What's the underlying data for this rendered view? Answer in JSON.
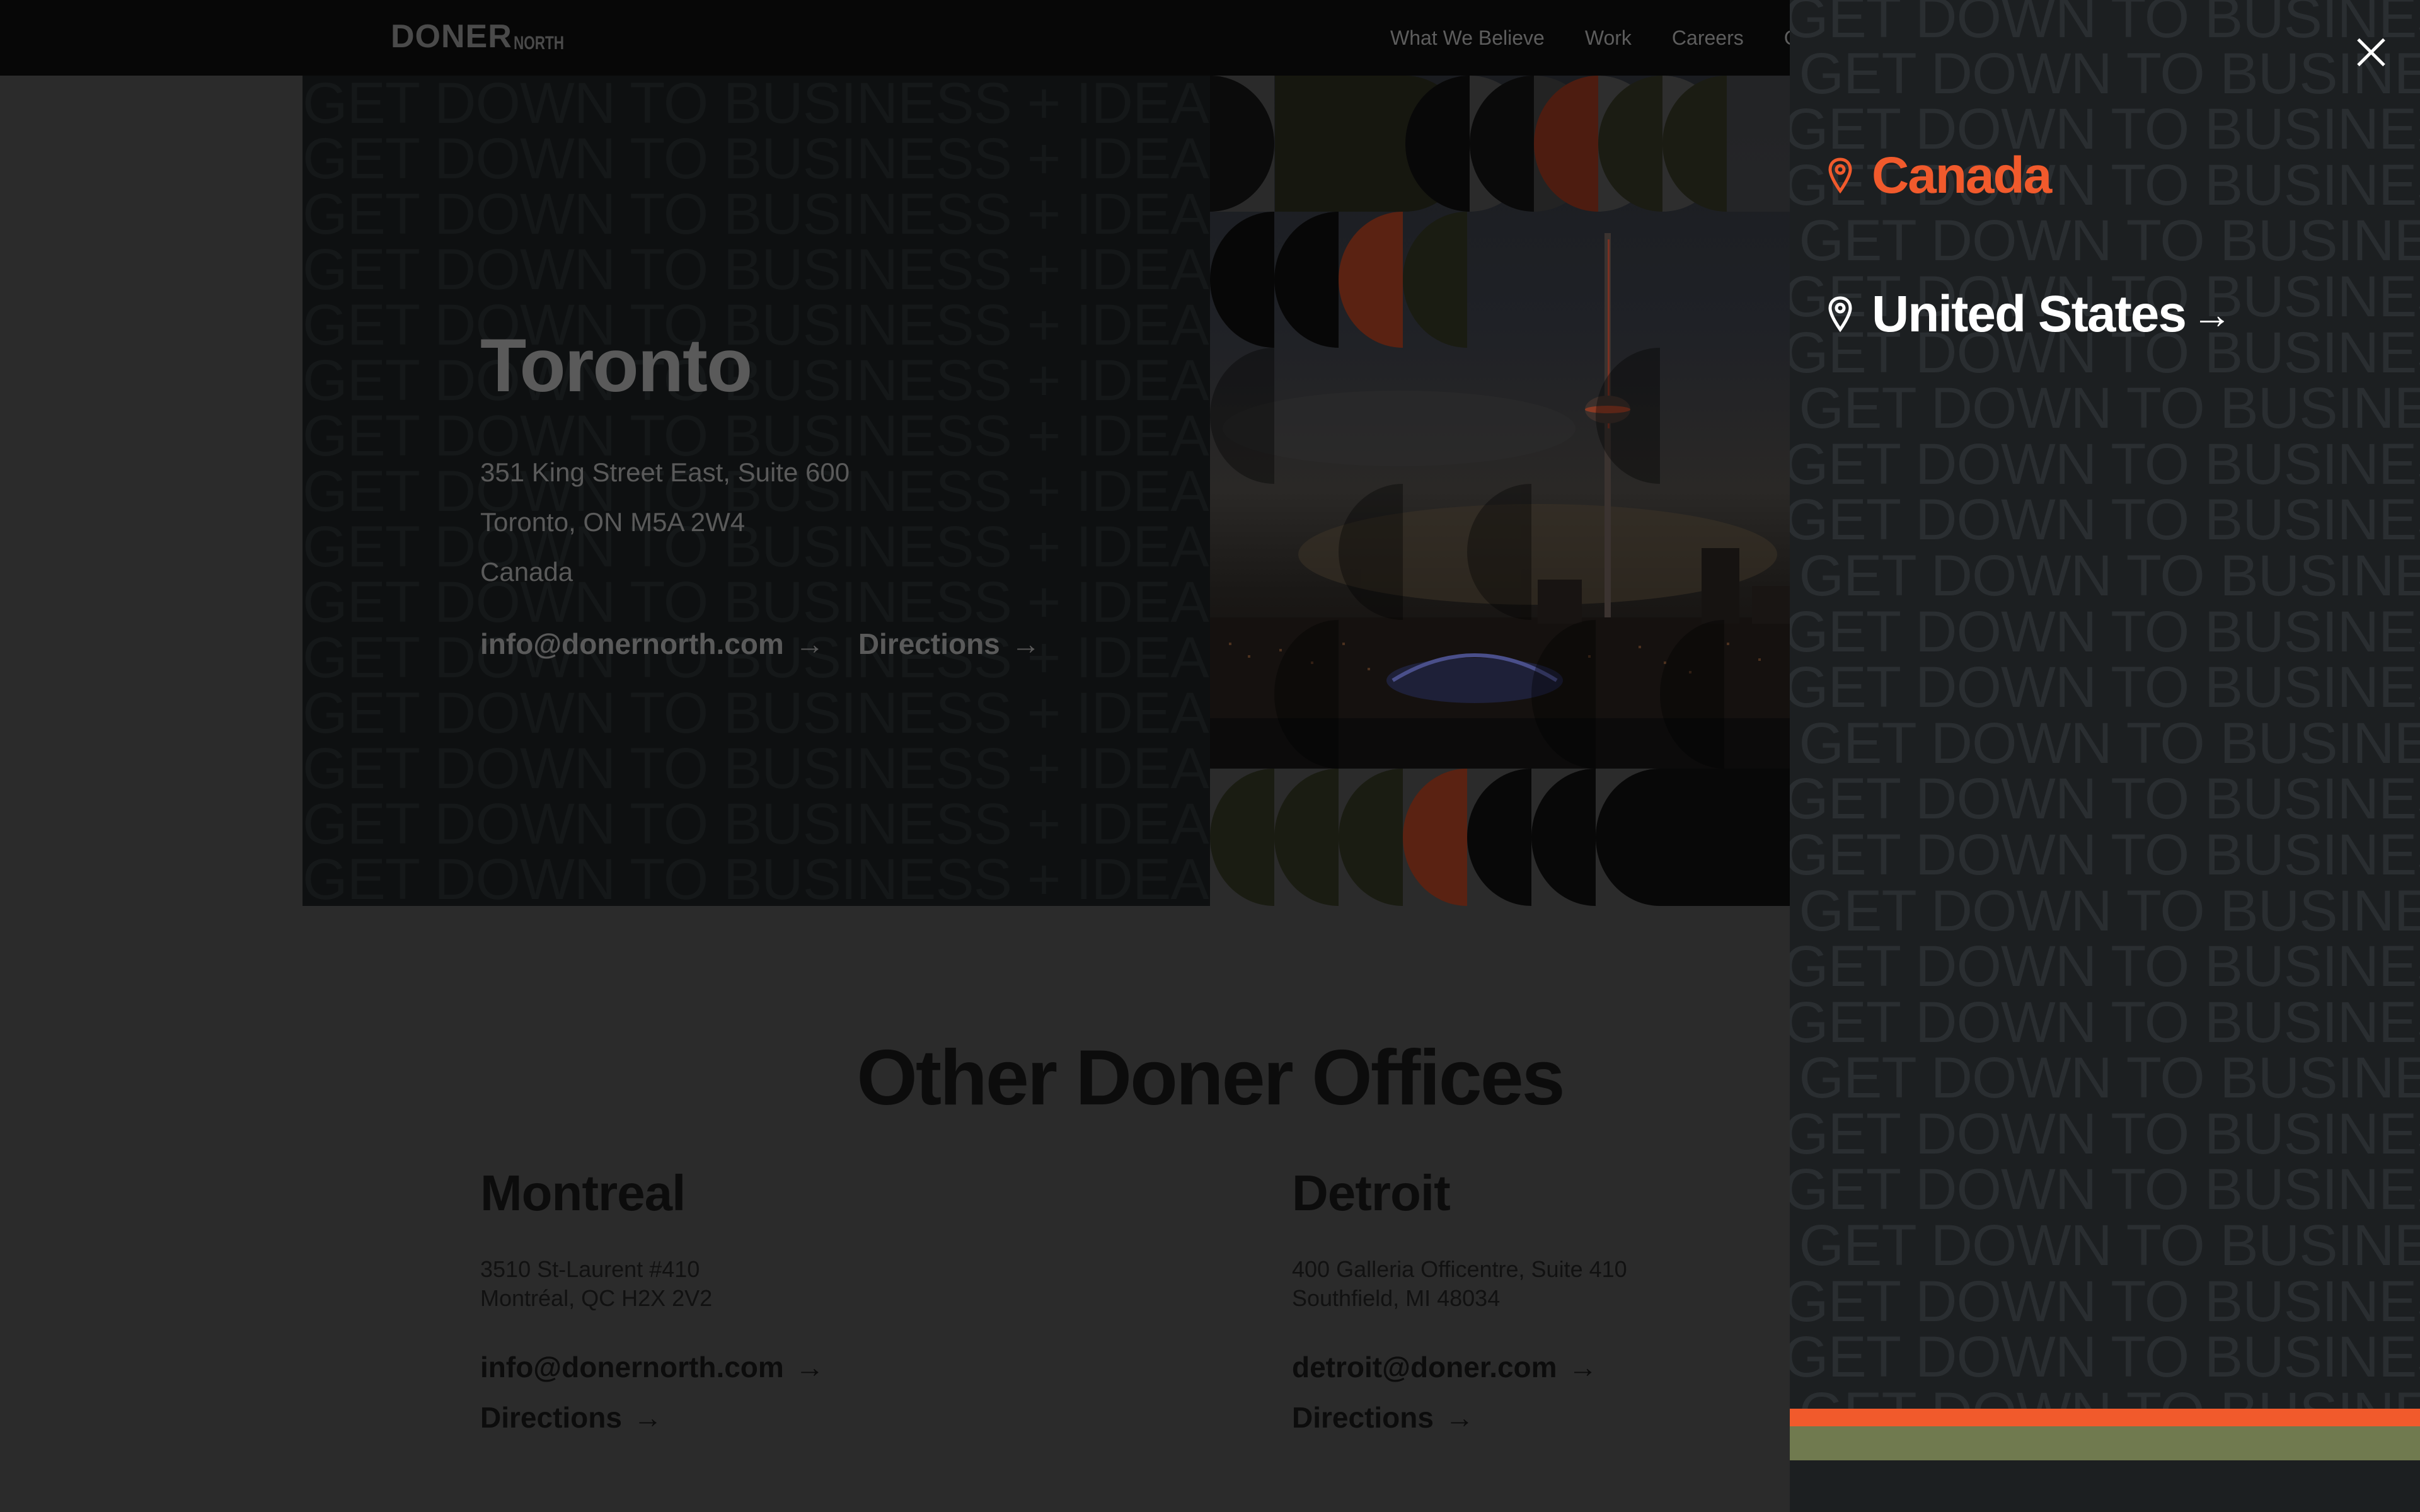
{
  "header": {
    "logo_main": "DONER",
    "logo_sub": "NORTH",
    "nav": [
      "What We Believe",
      "Work",
      "Careers",
      "Co"
    ]
  },
  "hero": {
    "city": "Toronto",
    "address_line1": "351 King Street East, Suite 600",
    "address_line2": "Toronto, ON M5A 2W4",
    "address_line3": "Canada",
    "email": "info@donernorth.com",
    "directions": "Directions"
  },
  "other": {
    "title": "Other Doner Offices",
    "offices": [
      {
        "name": "Montreal",
        "line1": "3510 St-Laurent #410",
        "line2": "Montréal, QC H2X 2V2",
        "email": "info@donernorth.com",
        "directions": "Directions"
      },
      {
        "name": "Detroit",
        "line1": "400 Galleria Officentre, Suite 410",
        "line2": "Southfield, MI 48034",
        "email": "detroit@doner.com",
        "directions": "Directions"
      }
    ]
  },
  "panel": {
    "countries": [
      {
        "label": "Canada",
        "active": true
      },
      {
        "label": "United States",
        "active": false
      }
    ],
    "pattern_text": "GET DOWN TO BUSINESS + IDEAS THAT GET DOWN TO BUSINESS + IDEAS THAT",
    "colors": {
      "accent": "#f15a2c",
      "olive": "#707a4f"
    }
  },
  "icons": [
    "close-icon",
    "map-pin-icon",
    "arrow-right-icon"
  ]
}
